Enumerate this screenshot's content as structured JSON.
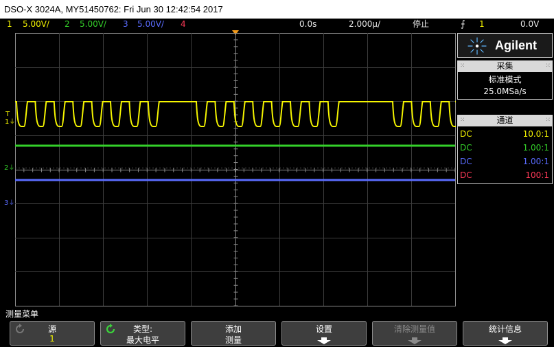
{
  "titlebar": {
    "text": "DSO-X 3024A, MY51450762: Fri Jun 30 12:42:54 2017"
  },
  "status": {
    "ch1": {
      "num": "1",
      "scale": "5.00V/"
    },
    "ch2": {
      "num": "2",
      "scale": "5.00V/"
    },
    "ch3": {
      "num": "3",
      "scale": "5.00V/"
    },
    "ch4": {
      "num": "4"
    },
    "delay": "0.0s",
    "timebase": "2.000µ/",
    "run_state": "停止",
    "trigger": {
      "icon": "trigger-edge-icon",
      "source": "1",
      "level": "0.0V"
    }
  },
  "brand": {
    "name": "Agilent",
    "logo": "agilent-spark-logo"
  },
  "acquisition": {
    "title": "采集",
    "mode": "标准模式",
    "rate": "25.0MSa/s"
  },
  "channels_panel": {
    "title": "通道",
    "rows": [
      {
        "coupling": "DC",
        "probe": "10.0:1",
        "color": "#f5f500"
      },
      {
        "coupling": "DC",
        "probe": "1.00:1",
        "color": "#34d12a"
      },
      {
        "coupling": "DC",
        "probe": "1.00:1",
        "color": "#5a6cff"
      },
      {
        "coupling": "DC",
        "probe": "100:1",
        "color": "#ff3a58"
      }
    ]
  },
  "markers": {
    "ch1": "1",
    "ch2": "2",
    "ch3": "3",
    "trig": "T"
  },
  "colors": {
    "ch1": "#f5f500",
    "ch2": "#34d12a",
    "ch3": "#5a6cff",
    "ch4": "#ff3a58",
    "trigger": "#f39a1a"
  },
  "menu": {
    "title": "测量菜单",
    "softkeys": [
      {
        "label": "源",
        "value": "1"
      },
      {
        "label": "类型:",
        "value": "最大电平"
      },
      {
        "label": "添加",
        "value": "测量"
      },
      {
        "label": "设置"
      },
      {
        "label": "清除测量值"
      },
      {
        "label": "统计信息"
      }
    ]
  }
}
